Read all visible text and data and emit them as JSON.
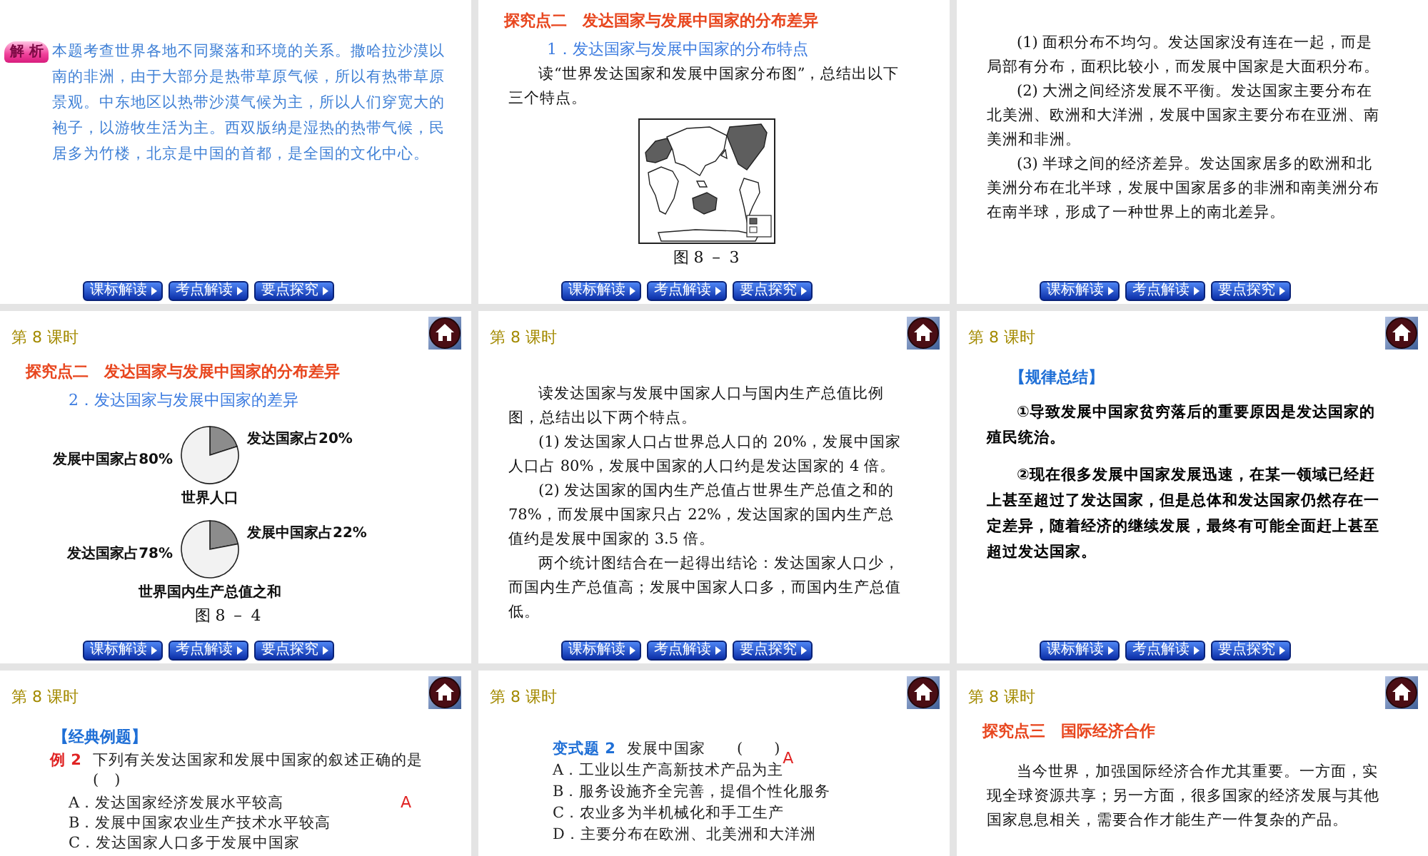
{
  "slides": [
    {
      "blocks": [
        {
          "kind": "analysis",
          "badge": "解 析",
          "text": "本题考查世界各地不同聚落和环境的关系。撒哈拉沙漠以南的非洲，由于大部分是热带草原气候，所以有热带草原景观。中东地区以热带沙漠气候为主，所以人们穿宽大的袍子，以游牧生活为主。西双版纳是湿热的热带气候，民居多为竹楼，北京是中国的首都，是全国的文化中心。"
        }
      ],
      "nav_buttons": [
        "课标解读",
        "考点解读",
        "要点探究"
      ]
    },
    {
      "blocks": [
        {
          "kind": "heading",
          "text": "探究点二　发达国家与发展中国家的分布差异"
        },
        {
          "kind": "subheading",
          "text": "1．发达国家与发展中国家的分布特点"
        },
        {
          "kind": "paragraph",
          "text": "读“世界发达国家和发展中国家分布图”，总结出以下三个特点。"
        },
        {
          "kind": "map"
        },
        {
          "kind": "caption",
          "text": "图 8 － 3"
        }
      ],
      "nav_buttons": [
        "课标解读",
        "考点解读",
        "要点探究"
      ]
    },
    {
      "blocks": [
        {
          "kind": "paragraph",
          "text": "(1) 面积分布不均匀。发达国家没有连在一起，而是局部有分布，面积比较小，而发展中国家是大面积分布。"
        },
        {
          "kind": "paragraph",
          "text": "(2) 大洲之间经济发展不平衡。发达国家主要分布在北美洲、欧洲和大洋洲，发展中国家主要分布在亚洲、南美洲和非洲。"
        },
        {
          "kind": "paragraph",
          "text": "(3) 半球之间的经济差异。发达国家居多的欧洲和北美洲分布在北半球，发展中国家居多的非洲和南美洲分布在南半球，形成了一种世界上的南北差异。"
        }
      ],
      "nav_buttons": [
        "课标解读",
        "考点解读",
        "要点探究"
      ]
    },
    {
      "header": "第 8 课时",
      "blocks": [
        {
          "kind": "heading",
          "text": "探究点二　发达国家与发展中国家的分布差异"
        },
        {
          "kind": "subheading",
          "text": "2．发达国家与发展中国家的差异"
        },
        {
          "kind": "pie",
          "chart_data": {
            "type": "pie",
            "title": "世界人口",
            "categories": [
              "发达国家占20%",
              "发展中国家占80%"
            ],
            "values": [
              20,
              80
            ]
          }
        },
        {
          "kind": "pie",
          "chart_data": {
            "type": "pie",
            "title": "世界国内生产总值之和",
            "categories": [
              "发展中国家占22%",
              "发达国家占78%"
            ],
            "values": [
              22,
              78
            ]
          }
        },
        {
          "kind": "caption",
          "text": "图 8 － 4"
        }
      ],
      "nav_buttons": [
        "课标解读",
        "考点解读",
        "要点探究"
      ]
    },
    {
      "header": "第 8 课时",
      "blocks": [
        {
          "kind": "paragraph",
          "text": "读发达国家与发展中国家人口与国内生产总值比例图，总结出以下两个特点。"
        },
        {
          "kind": "paragraph",
          "text": "(1) 发达国家人口占世界总人口的 20%，发展中国家人口占 80%，发展中国家的人口约是发达国家的 4 倍。"
        },
        {
          "kind": "paragraph",
          "text": "(2) 发达国家的国内生产总值占世界生产总值之和的 78%，而发展中国家只占 22%，发达国家的国内生产总值约是发展中国家的 3.5 倍。"
        },
        {
          "kind": "paragraph",
          "text": "两个统计图结合在一起得出结论：发达国家人口少，而国内生产总值高；发展中国家人口多，而国内生产总值低。"
        }
      ],
      "nav_buttons": [
        "课标解读",
        "考点解读",
        "要点探究"
      ]
    },
    {
      "header": "第 8 课时",
      "blocks": [
        {
          "kind": "label",
          "text": "【规律总结】"
        },
        {
          "kind": "strong_paragraph",
          "text": "①导致发展中国家贫穷落后的重要原因是发达国家的殖民统治。"
        },
        {
          "kind": "strong_paragraph",
          "text": "②现在很多发展中国家发展迅速，在某一领域已经赶上甚至超过了发达国家，但是总体和发达国家仍然存在一定差异，随着经济的继续发展，最终有可能全面赶上甚至超过发达国家。"
        }
      ],
      "nav_buttons": [
        "课标解读",
        "考点解读",
        "要点探究"
      ]
    },
    {
      "header": "第 8 课时",
      "blocks": [
        {
          "kind": "label",
          "text": "【经典例题】"
        },
        {
          "kind": "example",
          "number": "例 2",
          "text": "下列有关发达国家和发展中国家的叙述正确的是 (　)",
          "answer": "A"
        },
        {
          "kind": "option",
          "text": "A．发达国家经济发展水平较高"
        },
        {
          "kind": "option",
          "text": "B．发展中国家农业生产技术水平较高"
        },
        {
          "kind": "option",
          "text": "C．发达国家人口多于发展中国家"
        }
      ]
    },
    {
      "header": "第 8 课时",
      "blocks": [
        {
          "kind": "variant",
          "number": "变式题 2",
          "text": "发展中国家　　(　　)",
          "answer": "A"
        },
        {
          "kind": "option",
          "text": "A．工业以生产高新技术产品为主"
        },
        {
          "kind": "option",
          "text": "B．服务设施齐全完善，提倡个性化服务"
        },
        {
          "kind": "option",
          "text": "C．农业多为半机械化和手工生产"
        },
        {
          "kind": "option",
          "text": "D．主要分布在欧洲、北美洲和大洋洲"
        }
      ]
    },
    {
      "header": "第 8 课时",
      "blocks": [
        {
          "kind": "heading",
          "text": "探究点三　国际经济合作"
        },
        {
          "kind": "paragraph",
          "text": "当今世界，加强国际经济合作尤其重要。一方面，实现全球资源共享；另一方面，很多国家的经济发展与其他国家息息相关，需要合作才能生产一件复杂的产品。"
        }
      ]
    }
  ]
}
